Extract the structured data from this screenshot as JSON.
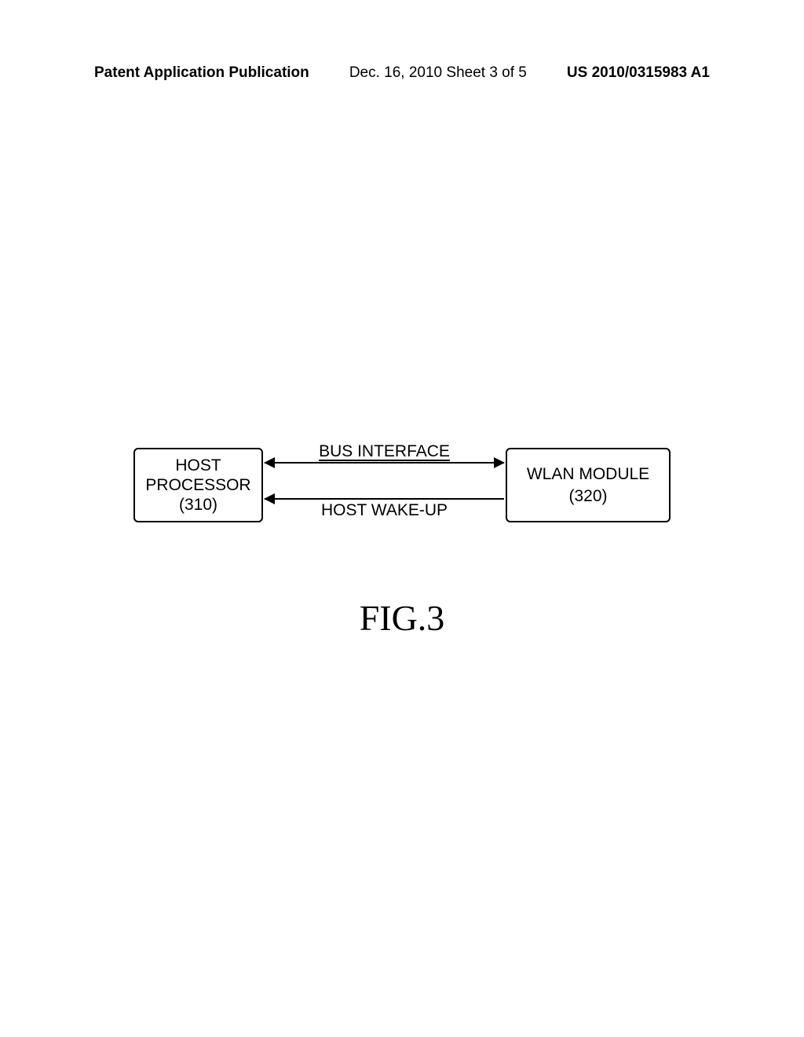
{
  "header": {
    "left": "Patent Application Publication",
    "center": "Dec. 16, 2010  Sheet 3 of 5",
    "right": "US 2010/0315983 A1"
  },
  "diagram": {
    "block_left": {
      "line1": "HOST",
      "line2": "PROCESSOR",
      "line3": "(310)"
    },
    "block_right": {
      "line1": "WLAN MODULE",
      "line2": "(320)"
    },
    "arrow_top_label": "BUS INTERFACE",
    "arrow_bottom_label": "HOST WAKE-UP"
  },
  "figure_label": "FIG.3",
  "chart_data": {
    "type": "table",
    "title": "Block diagram of host processor and WLAN module connection",
    "blocks": [
      {
        "name": "HOST PROCESSOR",
        "id": "310"
      },
      {
        "name": "WLAN MODULE",
        "id": "320"
      }
    ],
    "connections": [
      {
        "from": "310",
        "to": "320",
        "label": "BUS INTERFACE",
        "direction": "bidirectional"
      },
      {
        "from": "320",
        "to": "310",
        "label": "HOST WAKE-UP",
        "direction": "unidirectional"
      }
    ]
  }
}
